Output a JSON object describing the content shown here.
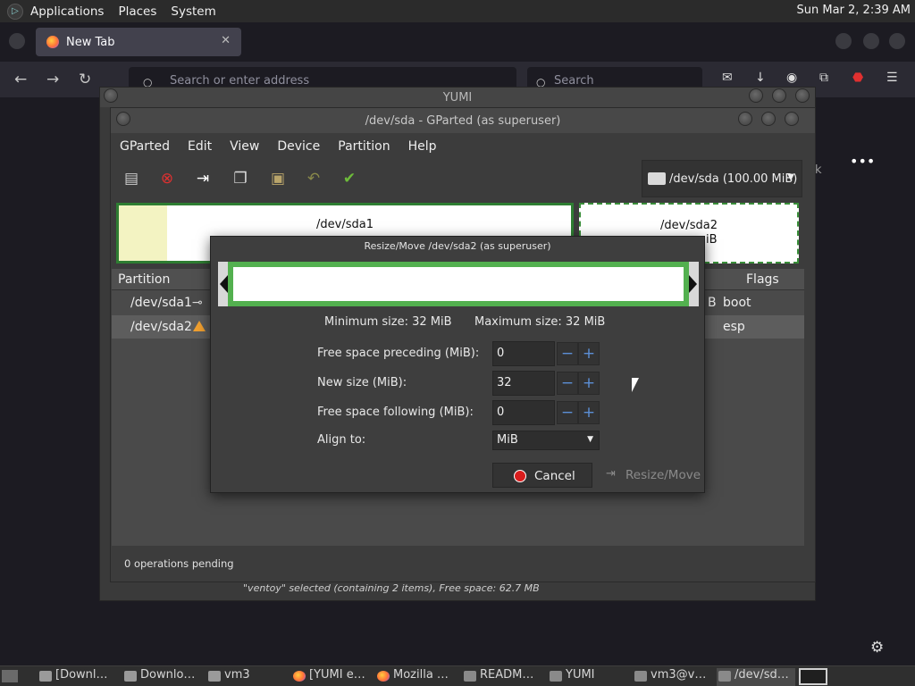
{
  "top_panel": {
    "menus": [
      "Applications",
      "Places",
      "System"
    ],
    "clock": "Sun Mar  2,  2:39 AM"
  },
  "firefox": {
    "tab_title": "New Tab",
    "address_placeholder": "Search or enter address",
    "search_placeholder": "Search",
    "right_dots": "•••",
    "partial_k": "k"
  },
  "yumi": {
    "title": "YUMI",
    "status": "\"ventoy\" selected (containing 2 items), Free space: 62.7 MB"
  },
  "gparted": {
    "title": "/dev/sda - GParted (as superuser)",
    "menus": [
      "GParted",
      "Edit",
      "View",
      "Device",
      "Partition",
      "Help"
    ],
    "device_selector": "/dev/sda (100.00 MiB)",
    "partition_map": {
      "sda1_label": "/dev/sda1",
      "sda2_label": "/dev/sda2",
      "sda2_size_partial": "iB"
    },
    "list_headers": {
      "partition": "Partition",
      "flags": "Flags"
    },
    "rows": [
      {
        "partition": "/dev/sda1",
        "size_partial": "B",
        "flags": "boot"
      },
      {
        "partition": "/dev/sda2",
        "size_partial": "",
        "flags": "esp"
      }
    ],
    "pending": "0 operations pending"
  },
  "dialog": {
    "title": "Resize/Move /dev/sda2 (as superuser)",
    "min_size": "Minimum size: 32 MiB",
    "max_size": "Maximum size: 32 MiB",
    "labels": {
      "free_preceding": "Free space preceding (MiB):",
      "new_size": "New size (MiB):",
      "free_following": "Free space following (MiB):",
      "align_to": "Align to:"
    },
    "values": {
      "free_preceding": "0",
      "new_size": "32",
      "free_following": "0",
      "align_to": "MiB"
    },
    "cancel_label": "Cancel",
    "resize_label": "Resize/Move"
  },
  "taskbar": {
    "items": [
      {
        "label": "[Downl…",
        "kind": "folder"
      },
      {
        "label": "Downlo…",
        "kind": "folder"
      },
      {
        "label": "vm3",
        "kind": "folder"
      },
      {
        "label": "[YUMI e…",
        "kind": "ff"
      },
      {
        "label": "Mozilla …",
        "kind": "ff"
      },
      {
        "label": "READM…",
        "kind": "doc"
      },
      {
        "label": "YUMI",
        "kind": "app"
      },
      {
        "label": "vm3@v…",
        "kind": "term"
      },
      {
        "label": "/dev/sd…",
        "kind": "app"
      }
    ]
  }
}
